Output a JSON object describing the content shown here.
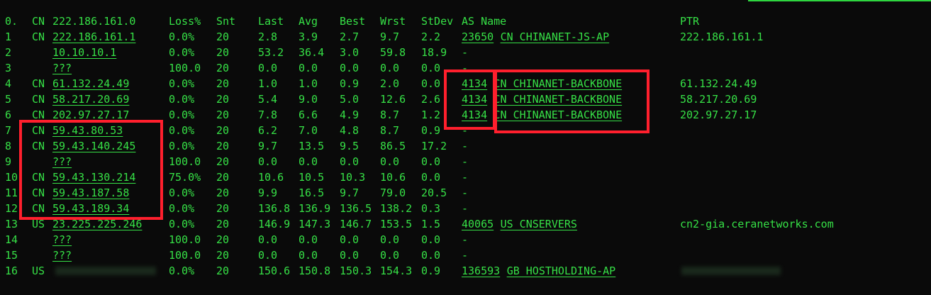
{
  "header": {
    "hop": "0.",
    "cc": "CN",
    "host": "222.186.161.0",
    "loss": "Loss%",
    "snt": "Snt",
    "last": "Last",
    "avg": "Avg",
    "best": "Best",
    "wrst": "Wrst",
    "stdev": "StDev",
    "asname": "AS Name",
    "ptr": "PTR"
  },
  "rows": [
    {
      "hop": "1",
      "cc": "CN",
      "host": "222.186.161.1",
      "loss": "0.0%",
      "snt": "20",
      "last": "2.8",
      "avg": "3.9",
      "best": "2.7",
      "wrst": "9.7",
      "stdev": "2.2",
      "asn": "23650",
      "asname": "CN CHINANET-JS-AP",
      "ptr": "222.186.161.1"
    },
    {
      "hop": "2",
      "cc": "",
      "host": "10.10.10.1",
      "loss": "0.0%",
      "snt": "20",
      "last": "53.2",
      "avg": "36.4",
      "best": "3.0",
      "wrst": "59.8",
      "stdev": "18.9",
      "asn": "-",
      "asname": "",
      "ptr": ""
    },
    {
      "hop": "3",
      "cc": "",
      "host": "???",
      "loss": "100.0",
      "snt": "20",
      "last": "0.0",
      "avg": "0.0",
      "best": "0.0",
      "wrst": "0.0",
      "stdev": "0.0",
      "asn": "-",
      "asname": "",
      "ptr": ""
    },
    {
      "hop": "4",
      "cc": "CN",
      "host": "61.132.24.49",
      "loss": "0.0%",
      "snt": "20",
      "last": "1.0",
      "avg": "1.0",
      "best": "0.9",
      "wrst": "2.0",
      "stdev": "0.0",
      "asn": "4134",
      "asname": "CN CHINANET-BACKBONE",
      "ptr": "61.132.24.49"
    },
    {
      "hop": "5",
      "cc": "CN",
      "host": "58.217.20.69",
      "loss": "0.0%",
      "snt": "20",
      "last": "5.4",
      "avg": "9.0",
      "best": "5.0",
      "wrst": "12.6",
      "stdev": "2.6",
      "asn": "4134",
      "asname": "CN CHINANET-BACKBONE",
      "ptr": "58.217.20.69"
    },
    {
      "hop": "6",
      "cc": "CN",
      "host": "202.97.27.17",
      "loss": "0.0%",
      "snt": "20",
      "last": "7.8",
      "avg": "6.6",
      "best": "4.9",
      "wrst": "8.7",
      "stdev": "1.2",
      "asn": "4134",
      "asname": "CN CHINANET-BACKBONE",
      "ptr": "202.97.27.17"
    },
    {
      "hop": "7",
      "cc": "CN",
      "host": "59.43.80.53",
      "loss": "0.0%",
      "snt": "20",
      "last": "6.2",
      "avg": "7.0",
      "best": "4.8",
      "wrst": "8.7",
      "stdev": "0.9",
      "asn": "-",
      "asname": "",
      "ptr": ""
    },
    {
      "hop": "8",
      "cc": "CN",
      "host": "59.43.140.245",
      "loss": "0.0%",
      "snt": "20",
      "last": "9.7",
      "avg": "13.5",
      "best": "9.5",
      "wrst": "86.5",
      "stdev": "17.2",
      "asn": "-",
      "asname": "",
      "ptr": ""
    },
    {
      "hop": "9",
      "cc": "",
      "host": "???",
      "loss": "100.0",
      "snt": "20",
      "last": "0.0",
      "avg": "0.0",
      "best": "0.0",
      "wrst": "0.0",
      "stdev": "0.0",
      "asn": "-",
      "asname": "",
      "ptr": ""
    },
    {
      "hop": "10",
      "cc": "CN",
      "host": "59.43.130.214",
      "loss": "75.0%",
      "snt": "20",
      "last": "10.6",
      "avg": "10.5",
      "best": "10.3",
      "wrst": "10.6",
      "stdev": "0.0",
      "asn": "-",
      "asname": "",
      "ptr": ""
    },
    {
      "hop": "11",
      "cc": "CN",
      "host": "59.43.187.58",
      "loss": "0.0%",
      "snt": "20",
      "last": "9.9",
      "avg": "16.5",
      "best": "9.7",
      "wrst": "79.0",
      "stdev": "20.5",
      "asn": "-",
      "asname": "",
      "ptr": ""
    },
    {
      "hop": "12",
      "cc": "CN",
      "host": "59.43.189.34",
      "loss": "0.0%",
      "snt": "20",
      "last": "136.8",
      "avg": "136.9",
      "best": "136.5",
      "wrst": "138.2",
      "stdev": "0.3",
      "asn": "-",
      "asname": "",
      "ptr": ""
    },
    {
      "hop": "13",
      "cc": "US",
      "host": "23.225.225.246",
      "loss": "0.0%",
      "snt": "20",
      "last": "146.9",
      "avg": "147.3",
      "best": "146.7",
      "wrst": "153.5",
      "stdev": "1.5",
      "asn": "40065",
      "asname": "US CNSERVERS",
      "ptr": "cn2-gia.ceranetworks.com"
    },
    {
      "hop": "14",
      "cc": "",
      "host": "???",
      "loss": "100.0",
      "snt": "20",
      "last": "0.0",
      "avg": "0.0",
      "best": "0.0",
      "wrst": "0.0",
      "stdev": "0.0",
      "asn": "-",
      "asname": "",
      "ptr": ""
    },
    {
      "hop": "15",
      "cc": "",
      "host": "???",
      "loss": "100.0",
      "snt": "20",
      "last": "0.0",
      "avg": "0.0",
      "best": "0.0",
      "wrst": "0.0",
      "stdev": "0.0",
      "asn": "-",
      "asname": "",
      "ptr": ""
    },
    {
      "hop": "16",
      "cc": "US",
      "host": "",
      "loss": "0.0%",
      "snt": "20",
      "last": "150.6",
      "avg": "150.8",
      "best": "150.3",
      "wrst": "154.3",
      "stdev": "0.9",
      "asn": "136593",
      "asname": "GB HOSTHOLDING-AP",
      "ptr": ""
    }
  ],
  "colors": {
    "background": "#0a0a0a",
    "text": "#36e046",
    "highlight_box": "#ff1f2d"
  }
}
